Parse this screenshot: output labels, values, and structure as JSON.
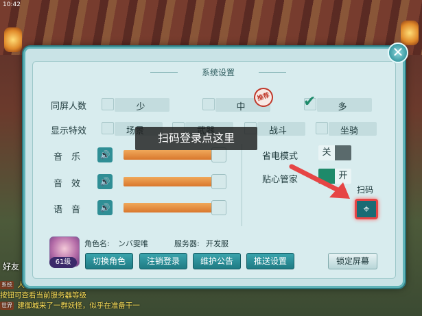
{
  "status_bar": {
    "time": "10:42"
  },
  "dialog": {
    "title": "系统设置",
    "close_label": "✕"
  },
  "players_row": {
    "label": "同屏人数",
    "options": [
      {
        "label": "少",
        "checked": false
      },
      {
        "label": "中",
        "checked": false,
        "badge": "推荐"
      },
      {
        "label": "多",
        "checked": true
      }
    ]
  },
  "effects_row": {
    "label": "显示特效",
    "options": [
      {
        "label": "场景",
        "checked": false
      },
      {
        "label": "武器",
        "checked": false
      },
      {
        "label": "战斗",
        "checked": false
      },
      {
        "label": "坐骑",
        "checked": false
      }
    ]
  },
  "audio": {
    "music_label": "音　乐",
    "effects_label": "音　效",
    "voice_label": "语　音",
    "music_level": 1.0,
    "effects_level": 1.0,
    "voice_level": 1.0,
    "icon": "speaker-icon"
  },
  "power_saving": {
    "label": "省电模式",
    "state_label": "关",
    "on": false
  },
  "care_manager": {
    "label": "贴心管家",
    "state_label": "开",
    "on": true
  },
  "scan": {
    "label": "扫码",
    "icon": "scan-icon"
  },
  "tooltip": "扫码登录点这里",
  "character": {
    "name_label": "角色名:",
    "name": "ンバ雯唯",
    "server_label": "服务器:",
    "server": "开发服",
    "level": "61级"
  },
  "buttons": {
    "switch_role": "切换角色",
    "logout": "注销登录",
    "maintenance": "维护公告",
    "push_settings": "推送设置",
    "lock_screen": "锁定屏幕"
  },
  "chat": {
    "line1_tag": "系统",
    "line1": "人物属性界面中，点击经验值旁边的",
    "line2": "按钮可查看当前服务器等级",
    "line3_tag": "世界",
    "line3": "建御城来了一群妖怪，似乎在准备干一"
  },
  "colors": {
    "accent": "#1f7b84",
    "slider_fill": "#d9772c",
    "highlight": "#e64545",
    "toggle_on": "#1e8a6a"
  }
}
